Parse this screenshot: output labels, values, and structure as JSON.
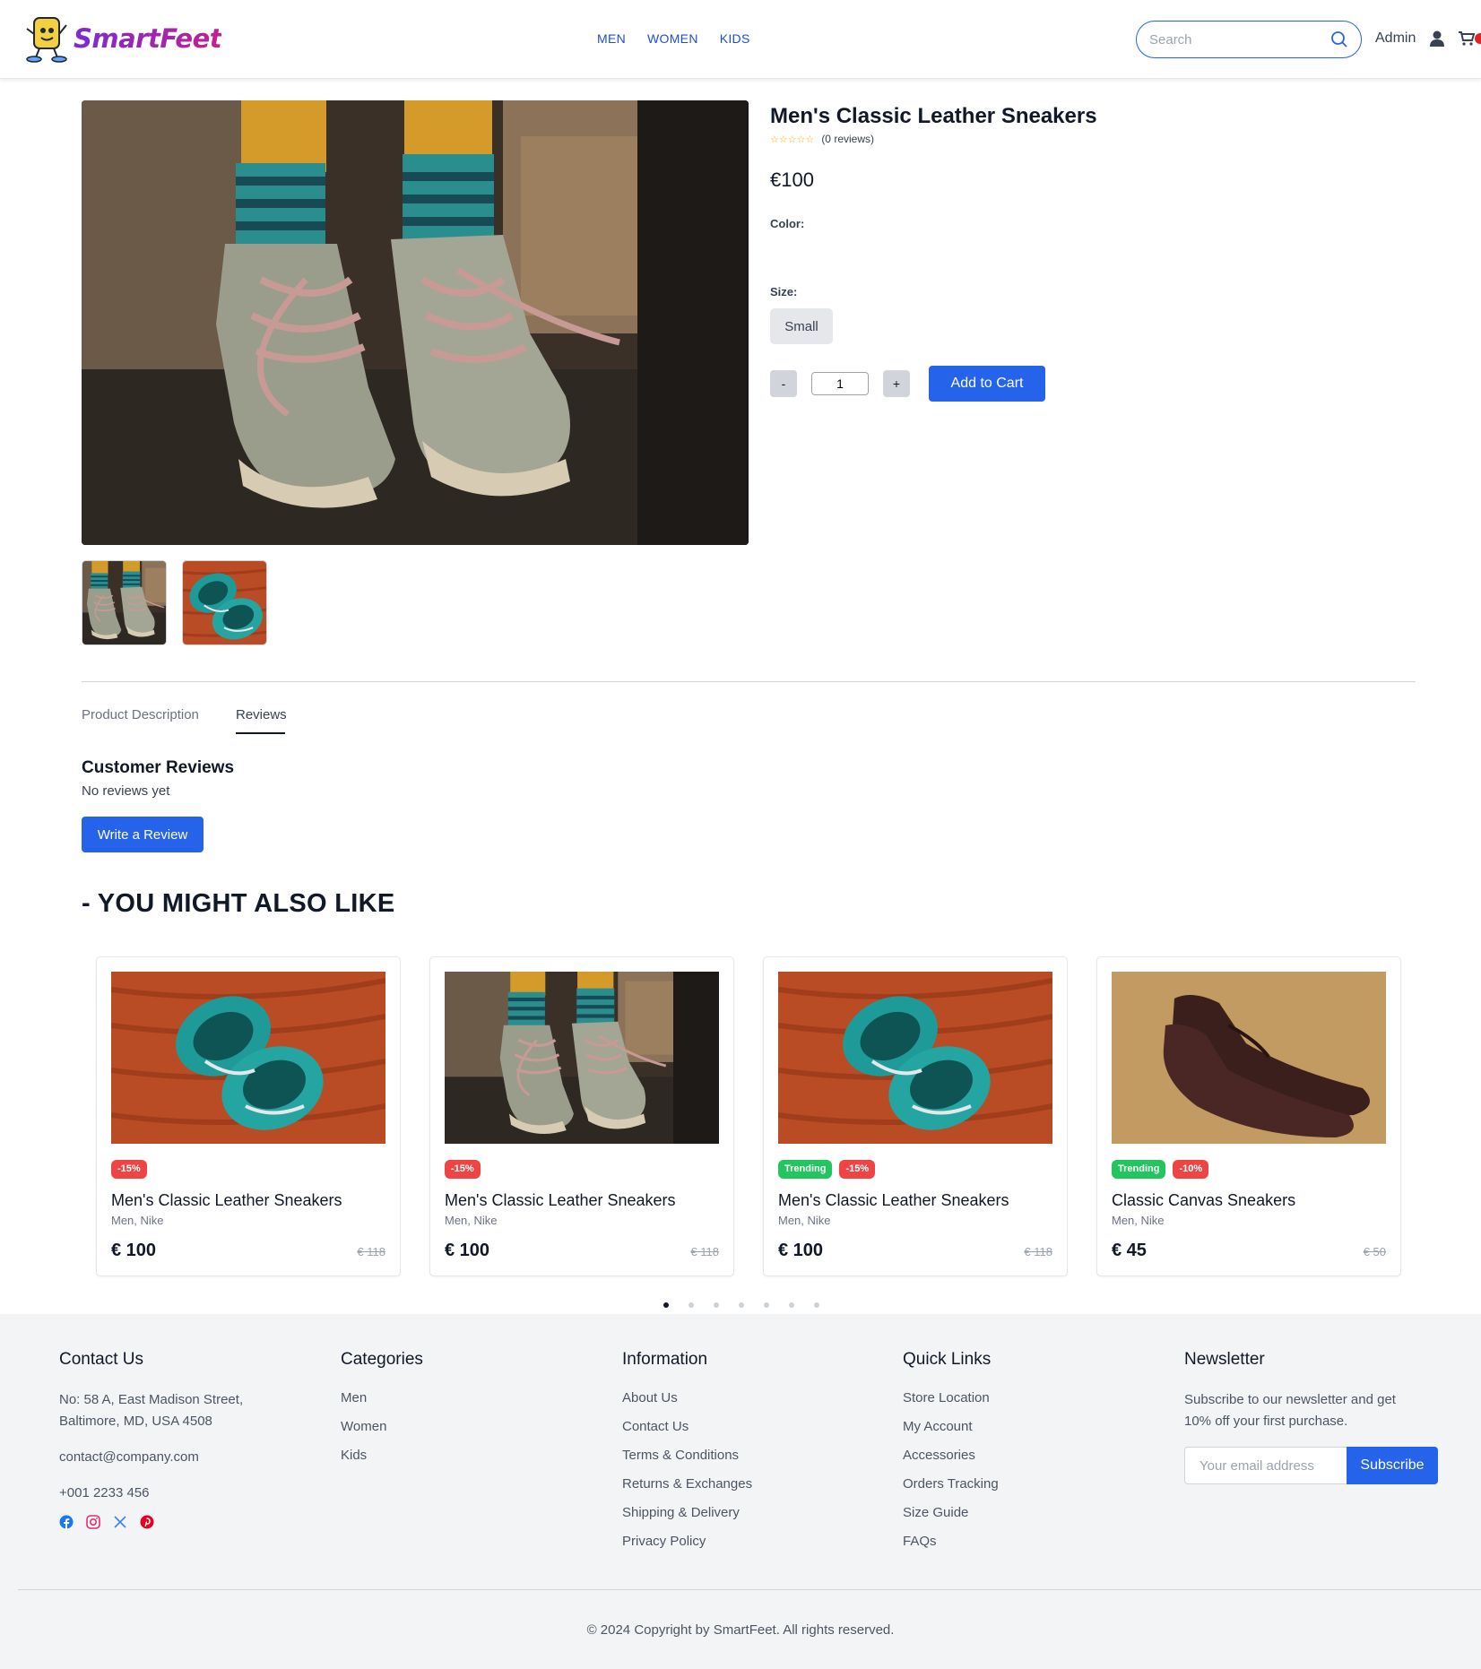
{
  "brand": {
    "name": "SmartFeet"
  },
  "nav": {
    "items": [
      "MEN",
      "WOMEN",
      "KIDS"
    ]
  },
  "header": {
    "search_placeholder": "Search",
    "admin_label": "Admin",
    "icons": [
      "search-icon",
      "user-icon",
      "cart-icon"
    ],
    "accent_color": "#2563eb"
  },
  "product": {
    "title": "Men's Classic Leather Sneakers",
    "rating_stars": "☆☆☆☆☆",
    "reviews_count": "(0 reviews)",
    "price": "€100",
    "color_label": "Color:",
    "size_label": "Size:",
    "size_option": "Small",
    "qty_minus": "-",
    "qty_value": "1",
    "qty_plus": "+",
    "add_to_cart": "Add to Cart"
  },
  "tabs": [
    {
      "label": "Product Description",
      "active": false
    },
    {
      "label": "Reviews",
      "active": true
    }
  ],
  "reviews": {
    "title": "Customer Reviews",
    "empty_text": "No reviews yet",
    "write_button": "Write a Review"
  },
  "related": {
    "heading": "- YOU MIGHT ALSO LIKE",
    "cards": [
      {
        "image": "teal-baby-shoes",
        "badges": [
          {
            "text": "-15%",
            "color": "red"
          }
        ],
        "name": "Men's Classic Leather Sneakers",
        "sub": "Men, Nike",
        "price": "€ 100",
        "old_price": "€ 118"
      },
      {
        "image": "kid-sneakers-socks",
        "badges": [
          {
            "text": "-15%",
            "color": "red"
          }
        ],
        "name": "Men's Classic Leather Sneakers",
        "sub": "Men, Nike",
        "price": "€ 100",
        "old_price": "€ 118"
      },
      {
        "image": "teal-baby-shoes",
        "badges": [
          {
            "text": "Trending",
            "color": "green"
          },
          {
            "text": "-15%",
            "color": "red"
          }
        ],
        "name": "Men's Classic Leather Sneakers",
        "sub": "Men, Nike",
        "price": "€ 100",
        "old_price": "€ 118"
      },
      {
        "image": "brown-brogues",
        "badges": [
          {
            "text": "Trending",
            "color": "green"
          },
          {
            "text": "-10%",
            "color": "red"
          }
        ],
        "name": "Classic Canvas Sneakers",
        "sub": "Men, Nike",
        "price": "€ 45",
        "old_price": "€ 50"
      }
    ],
    "carousel_dots": 7,
    "active_dot": 0
  },
  "footer": {
    "contact": {
      "title": "Contact Us",
      "address_line1": "No: 58 A, East Madison Street,",
      "address_line2": "Baltimore, MD, USA 4508",
      "email": "contact@company.com",
      "phone": "+001 2233 456",
      "social_icons": [
        "facebook-icon",
        "instagram-icon",
        "x-icon",
        "pinterest-icon"
      ]
    },
    "categories": {
      "title": "Categories",
      "items": [
        "Men",
        "Women",
        "Kids"
      ]
    },
    "information": {
      "title": "Information",
      "items": [
        "About Us",
        "Contact Us",
        "Terms & Conditions",
        "Returns & Exchanges",
        "Shipping & Delivery",
        "Privacy Policy"
      ]
    },
    "quick_links": {
      "title": "Quick Links",
      "items": [
        "Store Location",
        "My Account",
        "Accessories",
        "Orders Tracking",
        "Size Guide",
        "FAQs"
      ]
    },
    "newsletter": {
      "title": "Newsletter",
      "text_line1": "Subscribe to our newsletter and get",
      "text_line2": "10% off your first purchase.",
      "placeholder": "Your email address",
      "button": "Subscribe"
    },
    "copyright": "© 2024 Copyright by SmartFeet. All rights reserved."
  }
}
